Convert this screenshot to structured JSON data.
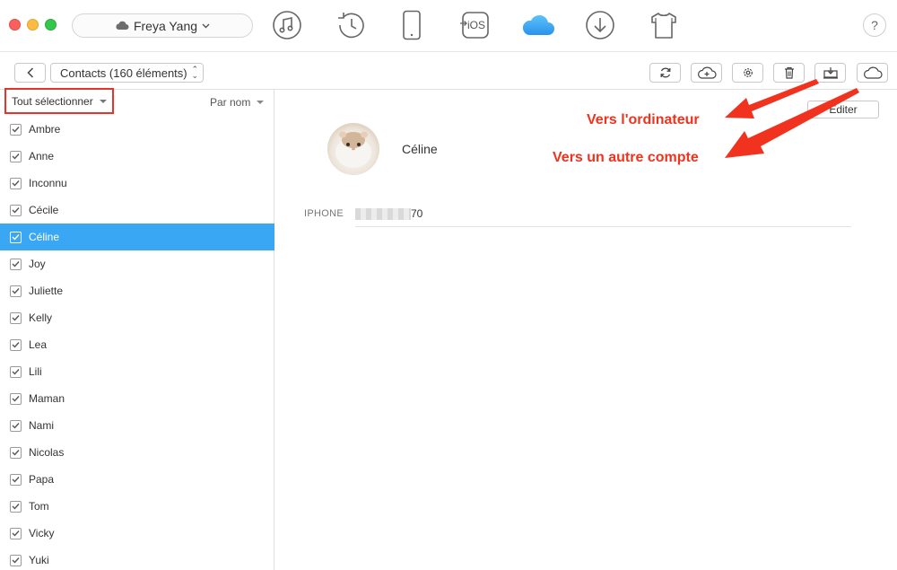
{
  "window": {
    "device_name": "Freya Yang",
    "help_label": "?",
    "top_icons": [
      "music-icon",
      "history-icon",
      "phone-icon",
      "to-ios-icon",
      "icloud-icon",
      "download-icon",
      "tshirt-icon"
    ],
    "to_ios_label": "iOS",
    "accent_color": "#3aa7f5"
  },
  "toolbar": {
    "category_label": "Contacts (160 éléments)",
    "buttons": [
      "refresh-icon",
      "cloud-upload-icon",
      "settings-icon",
      "trash-icon",
      "to-computer-icon",
      "to-cloud-icon"
    ]
  },
  "sidebar": {
    "select_all_label": "Tout sélectionner",
    "sort_label": "Par nom",
    "contacts": [
      {
        "name": "Ambre",
        "selected": false
      },
      {
        "name": "Anne",
        "selected": false
      },
      {
        "name": "Inconnu",
        "selected": false
      },
      {
        "name": "Cécile",
        "selected": false
      },
      {
        "name": "Céline",
        "selected": true
      },
      {
        "name": "Joy",
        "selected": false
      },
      {
        "name": "Juliette",
        "selected": false
      },
      {
        "name": "Kelly",
        "selected": false
      },
      {
        "name": "Lea",
        "selected": false
      },
      {
        "name": "Lili",
        "selected": false
      },
      {
        "name": "Maman",
        "selected": false
      },
      {
        "name": "Nami",
        "selected": false
      },
      {
        "name": "Nicolas",
        "selected": false
      },
      {
        "name": "Papa",
        "selected": false
      },
      {
        "name": "Tom",
        "selected": false
      },
      {
        "name": "Vicky",
        "selected": false
      },
      {
        "name": "Yuki",
        "selected": false
      }
    ]
  },
  "detail": {
    "edit_label": "Editer",
    "name": "Céline",
    "phone_label": "IPHONE",
    "phone_visible_suffix": "70"
  },
  "annotations": {
    "to_computer": "Vers l'ordinateur",
    "to_other_account": "Vers un autre compte",
    "color": "#f0321e"
  }
}
